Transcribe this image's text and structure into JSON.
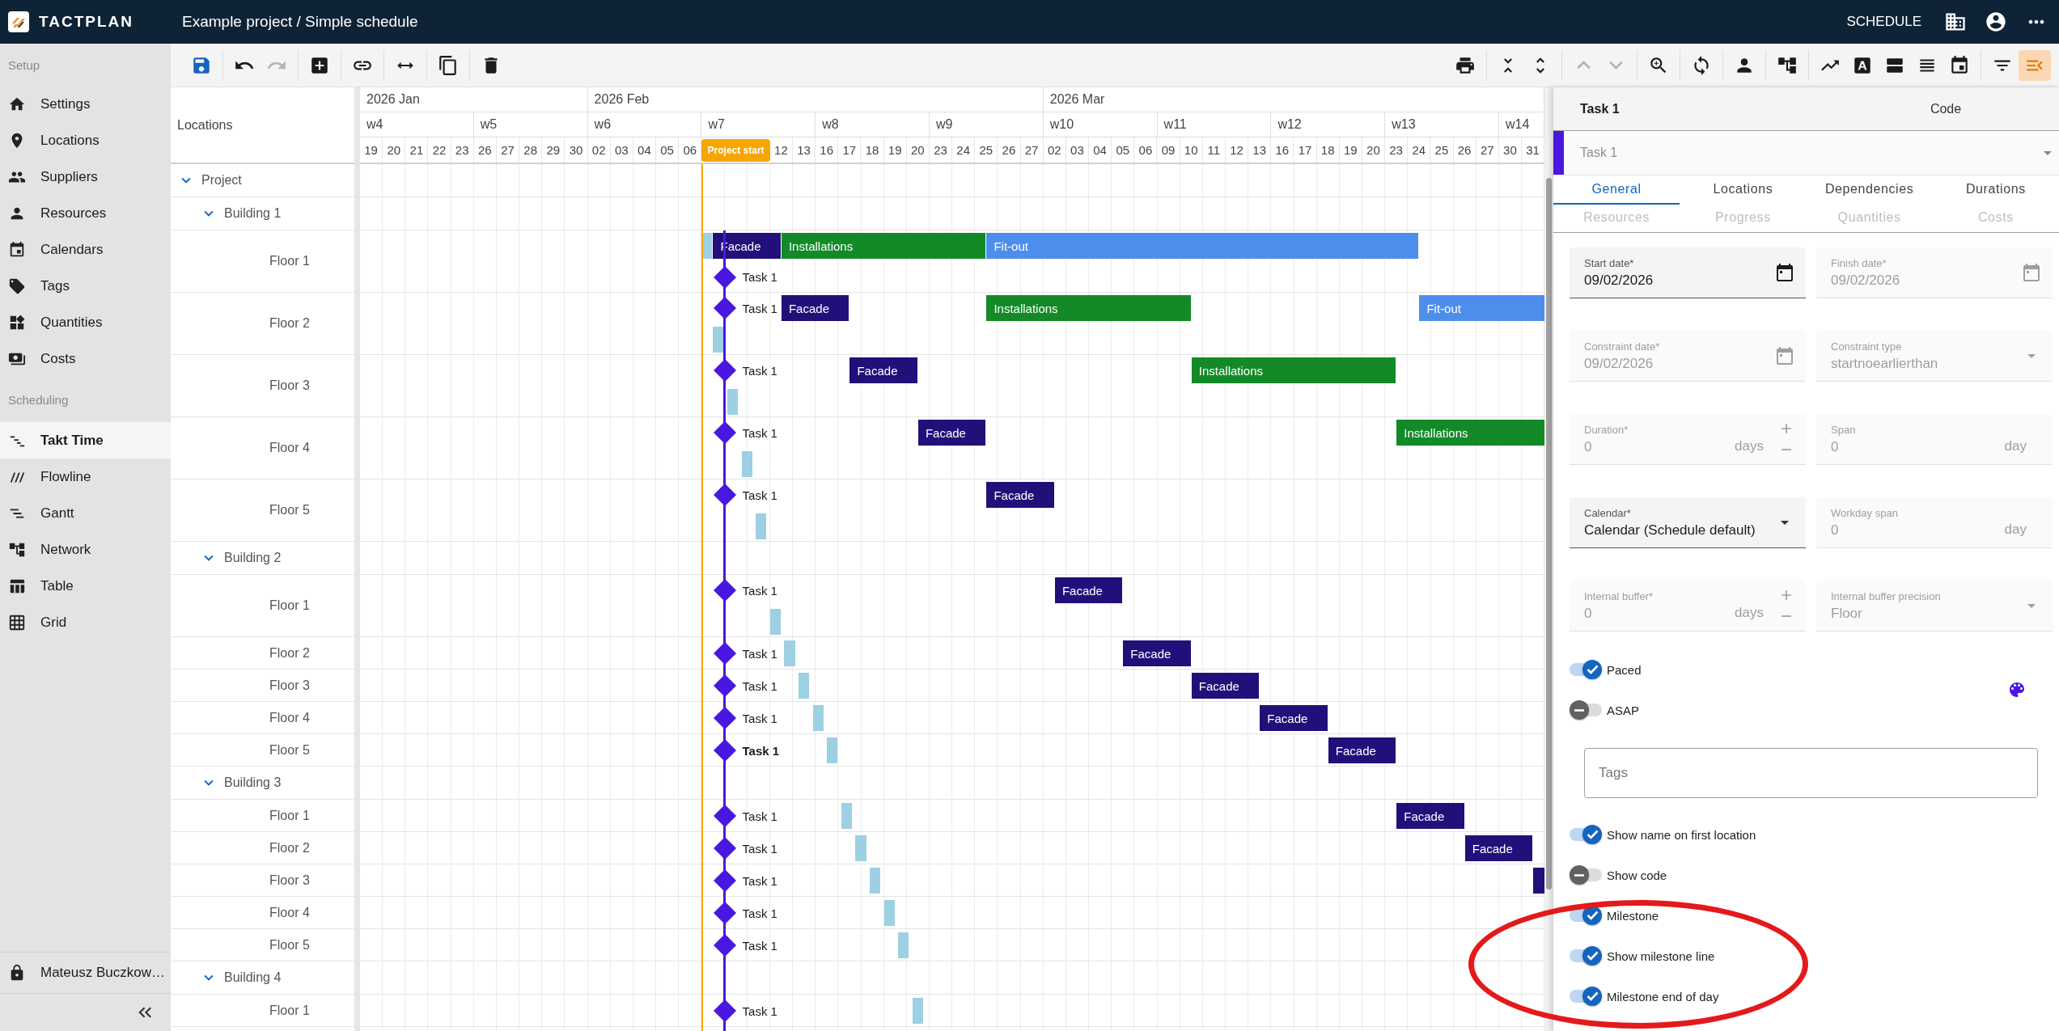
{
  "topbar": {
    "logo": "TACTPLAN",
    "breadcrumb": "Example project / Simple schedule",
    "section": "SCHEDULE"
  },
  "toolbar": {
    "left": [
      [
        {
          "disabled": false,
          "active": false
        }
      ],
      [
        {
          "disabled": false,
          "active": false
        },
        {
          "disabled": true,
          "active": false
        }
      ],
      [
        {
          "disabled": false,
          "active": false
        }
      ],
      [
        {
          "disabled": false,
          "active": false
        }
      ],
      [
        {
          "disabled": false,
          "active": false
        }
      ],
      [
        {
          "disabled": false,
          "active": false
        }
      ],
      [
        {
          "disabled": false,
          "active": false
        }
      ]
    ],
    "right": [
      [
        {
          "disabled": false,
          "active": false
        }
      ],
      [
        {
          "disabled": false,
          "active": false
        },
        {
          "disabled": false,
          "active": false
        }
      ],
      [
        {
          "disabled": true,
          "active": false
        },
        {
          "disabled": true,
          "active": false
        }
      ],
      [
        {
          "disabled": false,
          "active": false
        }
      ],
      [
        {
          "disabled": false,
          "active": false
        }
      ],
      [
        {
          "disabled": false,
          "active": false
        }
      ],
      [
        {
          "disabled": false,
          "active": false
        }
      ],
      [
        {
          "disabled": false,
          "active": false
        },
        {
          "disabled": false,
          "active": false
        },
        {
          "disabled": false,
          "active": false
        },
        {
          "disabled": false,
          "active": false
        },
        {
          "disabled": false,
          "active": false
        }
      ],
      [
        {
          "disabled": false,
          "active": false
        },
        {
          "disabled": false,
          "active": true
        }
      ]
    ]
  },
  "sidebar": {
    "sections": [
      {
        "title": "Setup",
        "items": [
          {
            "label": "Settings",
            "selected": false
          },
          {
            "label": "Locations",
            "selected": false
          },
          {
            "label": "Suppliers",
            "selected": false
          },
          {
            "label": "Resources",
            "selected": false
          },
          {
            "label": "Calendars",
            "selected": false
          },
          {
            "label": "Tags",
            "selected": false
          },
          {
            "label": "Quantities",
            "selected": false
          },
          {
            "label": "Costs",
            "selected": false
          }
        ]
      },
      {
        "title": "Scheduling",
        "items": [
          {
            "label": "Takt Time",
            "selected": true
          },
          {
            "label": "Flowline",
            "selected": false
          },
          {
            "label": "Gantt",
            "selected": false
          },
          {
            "label": "Network",
            "selected": false
          },
          {
            "label": "Table",
            "selected": false
          },
          {
            "label": "Grid",
            "selected": false
          }
        ]
      }
    ],
    "user": "Mateusz Buczkow…"
  },
  "timeline": {
    "header": "Locations",
    "months": [
      {
        "label": "2026 Jan",
        "weeks": [
          {
            "label": "w4",
            "days": [
              "19",
              "20",
              "21",
              "22",
              "23"
            ]
          },
          {
            "label": "w5",
            "days": [
              "26",
              "27",
              "28",
              "29",
              "30"
            ]
          }
        ]
      },
      {
        "label": "2026 Feb",
        "weeks": [
          {
            "label": "w6",
            "days": [
              "02",
              "03",
              "04",
              "05",
              "06"
            ]
          },
          {
            "label": "w7",
            "marker": "Project start",
            "days": [
              "12",
              "13"
            ]
          },
          {
            "label": "w8",
            "days": [
              "16",
              "17",
              "18",
              "19",
              "20"
            ]
          },
          {
            "label": "w9",
            "days": [
              "23",
              "24",
              "25",
              "26",
              "27"
            ]
          }
        ]
      },
      {
        "label": "2026 Mar",
        "weeks": [
          {
            "label": "w10",
            "days": [
              "02",
              "03",
              "04",
              "05",
              "06"
            ]
          },
          {
            "label": "w11",
            "days": [
              "09",
              "10",
              "11",
              "12",
              "13"
            ]
          },
          {
            "label": "w12",
            "days": [
              "16",
              "17",
              "18",
              "19",
              "20"
            ]
          },
          {
            "label": "w13",
            "days": [
              "23",
              "24",
              "25",
              "26",
              "27"
            ]
          },
          {
            "label": "w14",
            "days": [
              "30",
              "31"
            ]
          }
        ]
      }
    ]
  },
  "milestone_line": true,
  "locations": [
    {
      "name": "Project",
      "expanded": true,
      "children": [
        {
          "name": "Building 1",
          "expanded": true,
          "children": [
            {
              "name": "Floor 1",
              "lanes": [
                [
                  {
                    "kind": "bar",
                    "color": "#9dd0e2"
                  },
                  {
                    "kind": "bar",
                    "label": "Facade",
                    "color": "#21107a"
                  },
                  {
                    "kind": "bar",
                    "label": "Installations",
                    "color": "#138a27"
                  },
                  {
                    "kind": "bar",
                    "label": "Fit-out",
                    "color": "#4d8eec"
                  }
                ],
                [
                  {
                    "kind": "milestone",
                    "label": "Task 1",
                    "selected": false
                  }
                ]
              ]
            },
            {
              "name": "Floor 2",
              "lanes": [
                [
                  {
                    "kind": "milestone",
                    "label": "Task 1",
                    "selected": false
                  },
                  {
                    "kind": "bar",
                    "label": "Facade",
                    "color": "#21107a"
                  },
                  {
                    "kind": "bar",
                    "label": "Installations",
                    "color": "#138a27"
                  },
                  {
                    "kind": "bar",
                    "label": "Fit-out",
                    "color": "#4d8eec"
                  }
                ],
                [
                  {
                    "kind": "bar",
                    "color": "#9dd0e2"
                  }
                ]
              ]
            },
            {
              "name": "Floor 3",
              "lanes": [
                [
                  {
                    "kind": "milestone",
                    "label": "Task 1",
                    "selected": false
                  },
                  {
                    "kind": "bar",
                    "label": "Facade",
                    "color": "#21107a"
                  },
                  {
                    "kind": "bar",
                    "label": "Installations",
                    "color": "#138a27"
                  }
                ],
                [
                  {
                    "kind": "bar",
                    "color": "#9dd0e2"
                  }
                ]
              ]
            },
            {
              "name": "Floor 4",
              "lanes": [
                [
                  {
                    "kind": "milestone",
                    "label": "Task 1",
                    "selected": false
                  },
                  {
                    "kind": "bar",
                    "label": "Facade",
                    "color": "#21107a"
                  },
                  {
                    "kind": "bar",
                    "label": "Installations",
                    "color": "#138a27"
                  }
                ],
                [
                  {
                    "kind": "bar",
                    "color": "#9dd0e2"
                  }
                ]
              ]
            },
            {
              "name": "Floor 5",
              "lanes": [
                [
                  {
                    "kind": "milestone",
                    "label": "Task 1",
                    "selected": false
                  },
                  {
                    "kind": "bar",
                    "label": "Facade",
                    "color": "#21107a"
                  }
                ],
                [
                  {
                    "kind": "bar",
                    "color": "#9dd0e2"
                  }
                ]
              ]
            }
          ]
        },
        {
          "name": "Building 2",
          "expanded": true,
          "children": [
            {
              "name": "Floor 1",
              "lanes": [
                [
                  {
                    "kind": "milestone",
                    "label": "Task 1",
                    "selected": false
                  },
                  {
                    "kind": "bar",
                    "label": "Facade",
                    "color": "#21107a"
                  }
                ],
                [
                  {
                    "kind": "bar",
                    "color": "#9dd0e2"
                  }
                ]
              ]
            },
            {
              "name": "Floor 2",
              "lanes": [
                [
                  {
                    "kind": "milestone",
                    "label": "Task 1",
                    "selected": false
                  },
                  {
                    "kind": "bar",
                    "color": "#9dd0e2"
                  },
                  {
                    "kind": "bar",
                    "label": "Facade",
                    "color": "#21107a"
                  }
                ]
              ]
            },
            {
              "name": "Floor 3",
              "lanes": [
                [
                  {
                    "kind": "milestone",
                    "label": "Task 1",
                    "selected": false
                  },
                  {
                    "kind": "bar",
                    "color": "#9dd0e2"
                  },
                  {
                    "kind": "bar",
                    "label": "Facade",
                    "color": "#21107a"
                  }
                ]
              ]
            },
            {
              "name": "Floor 4",
              "lanes": [
                [
                  {
                    "kind": "milestone",
                    "label": "Task 1",
                    "selected": false
                  },
                  {
                    "kind": "bar",
                    "color": "#9dd0e2"
                  },
                  {
                    "kind": "bar",
                    "label": "Facade",
                    "color": "#21107a"
                  }
                ]
              ]
            },
            {
              "name": "Floor 5",
              "lanes": [
                [
                  {
                    "kind": "milestone",
                    "label": "Task 1",
                    "selected": true
                  },
                  {
                    "kind": "bar",
                    "color": "#9dd0e2"
                  },
                  {
                    "kind": "bar",
                    "label": "Facade",
                    "color": "#21107a"
                  }
                ]
              ]
            }
          ]
        },
        {
          "name": "Building 3",
          "expanded": true,
          "children": [
            {
              "name": "Floor 1",
              "lanes": [
                [
                  {
                    "kind": "milestone",
                    "label": "Task 1",
                    "selected": false
                  },
                  {
                    "kind": "bar",
                    "color": "#9dd0e2"
                  },
                  {
                    "kind": "bar",
                    "label": "Facade",
                    "color": "#21107a"
                  }
                ]
              ]
            },
            {
              "name": "Floor 2",
              "lanes": [
                [
                  {
                    "kind": "milestone",
                    "label": "Task 1",
                    "selected": false
                  },
                  {
                    "kind": "bar",
                    "color": "#9dd0e2"
                  },
                  {
                    "kind": "bar",
                    "label": "Facade",
                    "color": "#21107a"
                  }
                ]
              ]
            },
            {
              "name": "Floor 3",
              "lanes": [
                [
                  {
                    "kind": "milestone",
                    "label": "Task 1",
                    "selected": false
                  },
                  {
                    "kind": "bar",
                    "color": "#9dd0e2"
                  },
                  {
                    "kind": "bar",
                    "color": "#21107a"
                  }
                ]
              ]
            },
            {
              "name": "Floor 4",
              "lanes": [
                [
                  {
                    "kind": "milestone",
                    "label": "Task 1",
                    "selected": false
                  },
                  {
                    "kind": "bar",
                    "color": "#9dd0e2"
                  }
                ]
              ]
            },
            {
              "name": "Floor 5",
              "lanes": [
                [
                  {
                    "kind": "milestone",
                    "label": "Task 1",
                    "selected": false
                  },
                  {
                    "kind": "bar",
                    "color": "#9dd0e2"
                  }
                ]
              ]
            }
          ]
        },
        {
          "name": "Building 4",
          "expanded": true,
          "children": [
            {
              "name": "Floor 1",
              "lanes": [
                [
                  {
                    "kind": "milestone",
                    "label": "Task 1",
                    "selected": false
                  },
                  {
                    "kind": "bar",
                    "color": "#9dd0e2"
                  }
                ]
              ]
            }
          ]
        }
      ]
    }
  ],
  "panel": {
    "title": "Task 1",
    "code_label": "Code",
    "name_field": {
      "value": "Task 1",
      "color": "#4a17e0"
    },
    "tabs": [
      {
        "label": "General",
        "selected": true,
        "disabled": false
      },
      {
        "label": "Locations",
        "selected": false,
        "disabled": false
      },
      {
        "label": "Dependencies",
        "selected": false,
        "disabled": false
      },
      {
        "label": "Durations",
        "selected": false,
        "disabled": false
      },
      {
        "label": "Resources",
        "selected": false,
        "disabled": true
      },
      {
        "label": "Progress",
        "selected": false,
        "disabled": true
      },
      {
        "label": "Quantities",
        "selected": false,
        "disabled": true
      },
      {
        "label": "Costs",
        "selected": false,
        "disabled": true
      }
    ],
    "fields": [
      {
        "kind": "date",
        "label": "Start date*",
        "value": "09/02/2026",
        "disabled": false
      },
      {
        "kind": "date",
        "label": "Finish date*",
        "value": "09/02/2026",
        "disabled": true
      },
      {
        "kind": "date",
        "label": "Constraint date*",
        "value": "09/02/2026",
        "disabled": true
      },
      {
        "kind": "select",
        "label": "Constraint type",
        "value": "startnoearlierthan",
        "disabled": true
      },
      {
        "kind": "number",
        "label": "Duration*",
        "value": "0",
        "unit": "days",
        "stepper": true,
        "disabled": true
      },
      {
        "kind": "number",
        "label": "Span",
        "value": "0",
        "unit": "day",
        "stepper": false,
        "disabled": true
      },
      {
        "kind": "select",
        "label": "Calendar*",
        "value": "Calendar (Schedule default)",
        "disabled": false
      },
      {
        "kind": "number",
        "label": "Workday span",
        "value": "0",
        "unit": "day",
        "stepper": false,
        "disabled": true
      },
      {
        "kind": "number",
        "label": "Internal buffer*",
        "value": "0",
        "unit": "days",
        "stepper": true,
        "disabled": true
      },
      {
        "kind": "select",
        "label": "Internal buffer precision",
        "value": "Floor",
        "disabled": true
      }
    ],
    "toggles_top": [
      {
        "label": "Paced",
        "checked": true
      },
      {
        "label": "ASAP",
        "checked": false
      }
    ],
    "tags_field": {
      "placeholder": "Tags"
    },
    "toggles_bottom": [
      {
        "label": "Show name on first location",
        "checked": true
      },
      {
        "label": "Show code",
        "checked": false
      },
      {
        "label": "Milestone",
        "checked": true
      },
      {
        "label": "Show milestone line",
        "checked": true
      },
      {
        "label": "Milestone end of day",
        "checked": true
      }
    ]
  },
  "annotation": {
    "kind": "ellipse"
  }
}
